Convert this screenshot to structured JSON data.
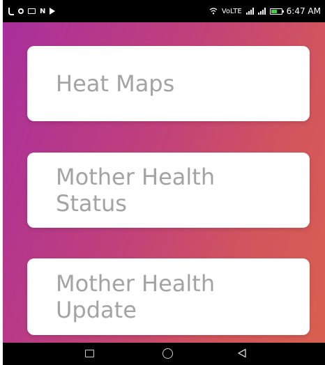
{
  "status_bar": {
    "time": "6:47 AM",
    "network_label": "VoLTE",
    "left_icons": [
      "phone-icon",
      "notification-icon",
      "mail-icon",
      "n-icon",
      "play-icon"
    ],
    "right_icons": [
      "wifi-icon",
      "signal-icon",
      "signal-icon",
      "battery-icon"
    ],
    "battery_color": "#3fd13f",
    "battery_level": 0.6
  },
  "background": {
    "gradient_start": "#a92f9c",
    "gradient_end": "#d9604f"
  },
  "menu": {
    "items": [
      {
        "label": "Heat Maps"
      },
      {
        "label": "Mother Health Status"
      },
      {
        "label": "Mother Health Update"
      }
    ]
  },
  "nav_bar": {
    "icons": [
      "recent-apps-icon",
      "home-icon",
      "back-icon"
    ]
  }
}
